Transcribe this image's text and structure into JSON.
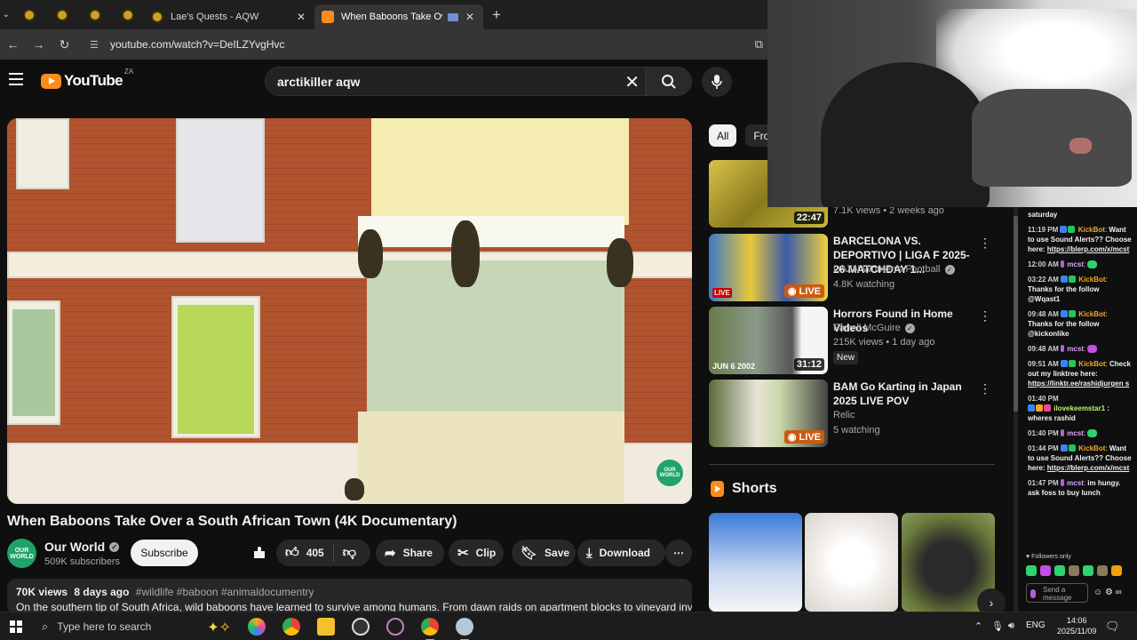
{
  "browser": {
    "tabs": [
      {
        "label": "Lae's Quests - AQW"
      },
      {
        "label": "When Baboons Take Over a"
      }
    ],
    "url": "youtube.com/watch?v=DeILZYvgHvc"
  },
  "youtube": {
    "logo_text": "YouTube",
    "country_code": "ZA",
    "search_value": "arctikiller aqw"
  },
  "video": {
    "title": "When Baboons Take Over a South African Town (4K Documentary)",
    "channel": "Our World",
    "channel_avatar_text": "OUR WORLD",
    "subscribers": "509K subscribers",
    "subscribe_label": "Subscribe",
    "likes": "405",
    "share_label": "Share",
    "clip_label": "Clip",
    "save_label": "Save",
    "download_label": "Download",
    "views": "70K views",
    "age": "8 days ago",
    "tags": "#wildlife #baboon #animaldocumentry",
    "description": "On the southern tip of South Africa, wild baboons have learned to survive among humans. From dawn raids on apartment blocks to vineyard invasions"
  },
  "filter_chips": [
    "All",
    "Fro"
  ],
  "recommendations": [
    {
      "title": "",
      "channel": "",
      "meta": "7.1K views • 2 weeks ago",
      "duration": "22:47"
    },
    {
      "title": "BARCELONA VS. DEPORTIVO | LIGA F 2025-26 MATCHDAY 1...",
      "channel": "DAZN Women's Football",
      "meta": "4.8K watching",
      "live": "LIVE",
      "thumb_badge": "LIVE"
    },
    {
      "title": "Horrors Found in Home Videos",
      "channel": "Farrell McGuire",
      "meta": "215K views • 1 day ago",
      "badge": "New",
      "duration": "31:12",
      "thumb_date": "JUN  6  2002"
    },
    {
      "title": "BAM Go Karting in Japan 2025 LIVE POV",
      "channel": "Relic",
      "meta": "5 watching",
      "live": "LIVE"
    }
  ],
  "shorts": {
    "title": "Shorts"
  },
  "chat": {
    "messages": [
      {
        "time": "",
        "user": "",
        "text": "saturday"
      },
      {
        "time": "11:19 PM",
        "user": "KickBot",
        "text": "Want to use Sound Alerts?? Choose here:",
        "link": "https://blerp.com/x/mcst"
      },
      {
        "time": "12:00 AM",
        "user": "mcst",
        "text": ""
      },
      {
        "time": "03:22 AM",
        "user": "KickBot",
        "text": "Thanks for the follow @Wqast1"
      },
      {
        "time": "09:48 AM",
        "user": "KickBot",
        "text": "Thanks for the follow @kickonlike"
      },
      {
        "time": "09:48 AM",
        "user": "mcst",
        "text": ""
      },
      {
        "time": "09:51 AM",
        "user": "KickBot",
        "text": "Check out my linktree here:",
        "link": "https://linktr.ee/rashidjurgen s"
      },
      {
        "time": "01:40 PM",
        "user": "ilovekeemstar1",
        "text": ": wheres rashid"
      },
      {
        "time": "01:40 PM",
        "user": "mcst",
        "text": ""
      },
      {
        "time": "01:44 PM",
        "user": "KickBot",
        "text": "Want to use Sound Alerts?? Choose here:",
        "link": "https://blerp.com/x/mcst"
      },
      {
        "time": "01:47 PM",
        "user": "mcst",
        "text": "im hungy. ask foss to buy lunch"
      }
    ],
    "followers_only": "Followers only",
    "input_placeholder": "Send a message"
  },
  "taskbar": {
    "search_placeholder": "Type here to search",
    "language": "ENG",
    "time": "14:06",
    "date": "2025/11/09"
  },
  "colors": {
    "accent": "#ff8c1a",
    "live": "#cc5a0e",
    "chat_bot": "#f5a623",
    "chat_user": "#dfa0ff"
  }
}
